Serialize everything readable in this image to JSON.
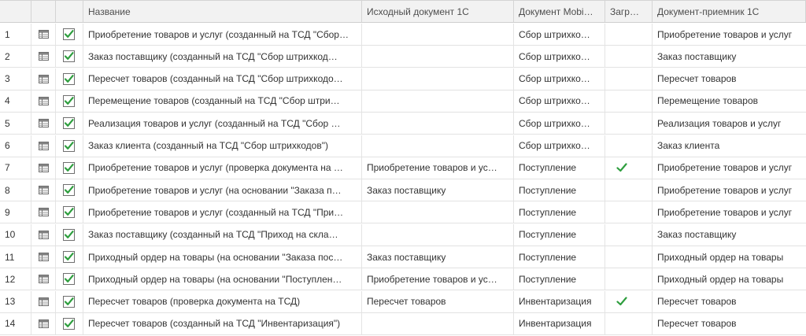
{
  "columns": {
    "num": "",
    "icon": "",
    "check": "",
    "name": "Название",
    "source": "Исходный документ 1С",
    "mobile": "Документ Mobi…",
    "loaded": "Загр…",
    "target": "Документ-приемник 1С"
  },
  "icons": {
    "row_icon": "table-icon",
    "check": "checkbox-checked-icon",
    "loaded": "checkmark-icon"
  },
  "colors": {
    "check_green": "#2e9e3e",
    "header_bg": "#f2f2f2"
  },
  "rows": [
    {
      "num": "1",
      "name": "Приобретение товаров и услуг (созданный на ТСД \"Сбор…",
      "source": "",
      "mobile": "Сбор штрихко…",
      "loaded": false,
      "target": "Приобретение товаров и услуг"
    },
    {
      "num": "2",
      "name": "Заказ поставщику (созданный на ТСД \"Сбор штрихкод…",
      "source": "",
      "mobile": "Сбор штрихко…",
      "loaded": false,
      "target": "Заказ поставщику"
    },
    {
      "num": "3",
      "name": "Пересчет товаров (созданный на ТСД \"Сбор штрихкодо…",
      "source": "",
      "mobile": "Сбор штрихко…",
      "loaded": false,
      "target": "Пересчет товаров"
    },
    {
      "num": "4",
      "name": "Перемещение товаров (созданный на ТСД \"Сбор штри…",
      "source": "",
      "mobile": "Сбор штрихко…",
      "loaded": false,
      "target": "Перемещение товаров"
    },
    {
      "num": "5",
      "name": "Реализация товаров и услуг (созданный на ТСД \"Сбор …",
      "source": "",
      "mobile": "Сбор штрихко…",
      "loaded": false,
      "target": "Реализация товаров и услуг"
    },
    {
      "num": "6",
      "name": "Заказ клиента (созданный на ТСД \"Сбор штрихкодов\")",
      "source": "",
      "mobile": "Сбор штрихко…",
      "loaded": false,
      "target": "Заказ клиента"
    },
    {
      "num": "7",
      "name": "Приобретение товаров и услуг (проверка документа на …",
      "source": "Приобретение товаров и ус…",
      "mobile": "Поступление",
      "loaded": true,
      "target": "Приобретение товаров и услуг"
    },
    {
      "num": "8",
      "name": "Приобретение товаров и услуг (на основании \"Заказа п…",
      "source": "Заказ поставщику",
      "mobile": "Поступление",
      "loaded": false,
      "target": "Приобретение товаров и услуг"
    },
    {
      "num": "9",
      "name": "Приобретение товаров и услуг (созданный на ТСД \"При…",
      "source": "",
      "mobile": "Поступление",
      "loaded": false,
      "target": "Приобретение товаров и услуг"
    },
    {
      "num": "10",
      "name": "Заказ поставщику (созданный на ТСД \"Приход на скла…",
      "source": "",
      "mobile": "Поступление",
      "loaded": false,
      "target": "Заказ поставщику"
    },
    {
      "num": "11",
      "name": "Приходный ордер на товары (на основании \"Заказа пос…",
      "source": "Заказ поставщику",
      "mobile": "Поступление",
      "loaded": false,
      "target": "Приходный ордер на товары"
    },
    {
      "num": "12",
      "name": "Приходный ордер на товары (на основании \"Поступлен…",
      "source": "Приобретение товаров и ус…",
      "mobile": "Поступление",
      "loaded": false,
      "target": "Приходный ордер на товары"
    },
    {
      "num": "13",
      "name": "Пересчет товаров (проверка документа на ТСД)",
      "source": "Пересчет товаров",
      "mobile": "Инвентаризация",
      "loaded": true,
      "target": "Пересчет товаров"
    },
    {
      "num": "14",
      "name": "Пересчет товаров (созданный на ТСД \"Инвентаризация\")",
      "source": "",
      "mobile": "Инвентаризация",
      "loaded": false,
      "target": "Пересчет товаров"
    }
  ]
}
